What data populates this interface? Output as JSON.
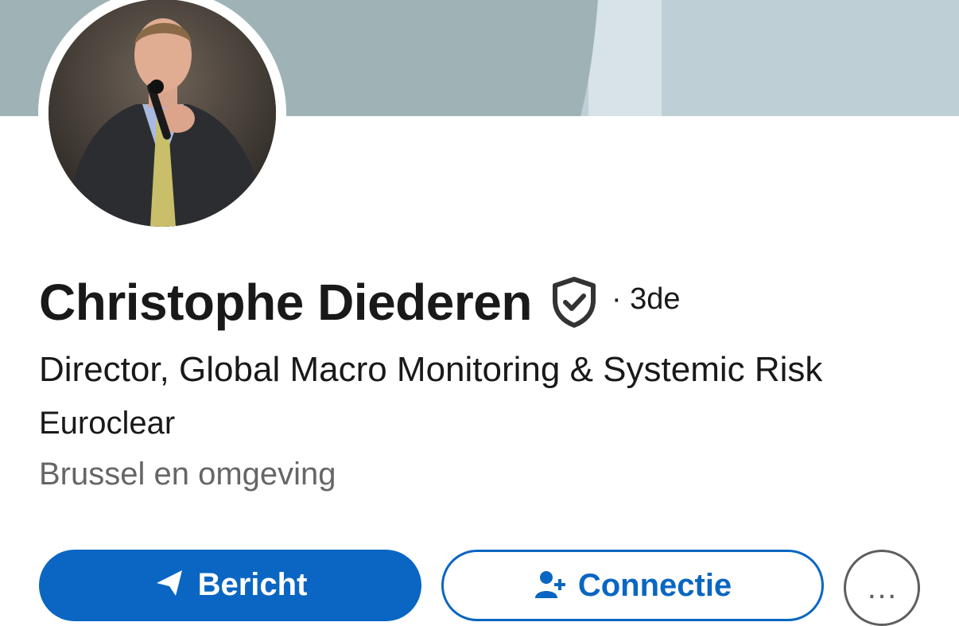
{
  "profile": {
    "name": "Christophe Diederen",
    "verified_icon": "shield-check-icon",
    "degree": "· 3de",
    "headline": "Director, Global Macro Monitoring & Systemic Risk",
    "company": "Euroclear",
    "location": "Brussel en omgeving",
    "avatar_description": "profile-photo"
  },
  "actions": {
    "primary_label": "Bericht",
    "primary_icon": "send-icon",
    "secondary_label": "Connectie",
    "secondary_icon": "person-add-icon",
    "more_label": "…",
    "more_icon": "more-icon"
  },
  "colors": {
    "accent": "#0a66c2",
    "banner_light": "#bed0d5",
    "banner_dark": "#9fb3b7",
    "text_primary": "#191919",
    "text_secondary": "#666666"
  }
}
